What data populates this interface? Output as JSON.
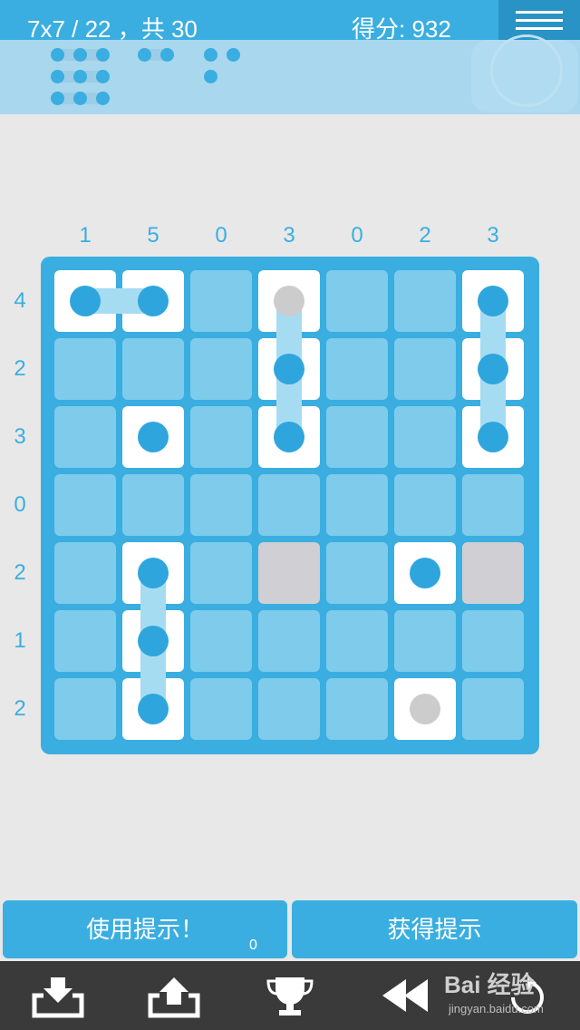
{
  "header": {
    "level_text": "7x7 / 22  ，共 30",
    "score_text": "得分: 932",
    "menu_icon": "hamburger-menu-icon"
  },
  "fleet": [
    {
      "length": 3,
      "remaining": 3
    },
    {
      "length": 2,
      "remaining": 1
    },
    {
      "length": 1,
      "remaining": 3
    }
  ],
  "puzzle": {
    "size": 7,
    "column_clues": [
      "1",
      "5",
      "0",
      "3",
      "0",
      "2",
      "3"
    ],
    "row_clues": [
      "4",
      "2",
      "3",
      "0",
      "2",
      "1",
      "2"
    ],
    "cells": [
      [
        "ship-blue",
        "ship-blue",
        "",
        "ship-grey",
        "",
        "",
        "ship-blue"
      ],
      [
        "",
        "",
        "",
        "ship-blue",
        "",
        "",
        "ship-blue"
      ],
      [
        "",
        "ship-blue",
        "",
        "ship-blue",
        "",
        "",
        "ship-blue"
      ],
      [
        "",
        "",
        "",
        "",
        "",
        "",
        ""
      ],
      [
        "",
        "ship-blue",
        "",
        "water",
        "",
        "ship-blue",
        "water"
      ],
      [
        "",
        "ship-blue",
        "",
        "",
        "",
        "",
        ""
      ],
      [
        "",
        "ship-blue",
        "",
        "",
        "",
        "ship-grey",
        ""
      ]
    ],
    "connections": [
      {
        "row": 0,
        "from": 0,
        "to": 1,
        "dir": "h"
      },
      {
        "col": 3,
        "from": 0,
        "to": 2,
        "dir": "v"
      },
      {
        "col": 6,
        "from": 0,
        "to": 2,
        "dir": "v"
      },
      {
        "col": 1,
        "from": 4,
        "to": 6,
        "dir": "v"
      }
    ]
  },
  "buttons": {
    "use_hint": "使用提示！",
    "hint_count": "0",
    "get_hints": "获得提示"
  },
  "toolbar": {
    "icons": [
      "download-icon",
      "upload-icon",
      "trophy-icon",
      "rewind-icon",
      "undo-icon"
    ]
  },
  "watermark": {
    "text": "Bai 经验",
    "url": "jingyan.baidu.com"
  }
}
